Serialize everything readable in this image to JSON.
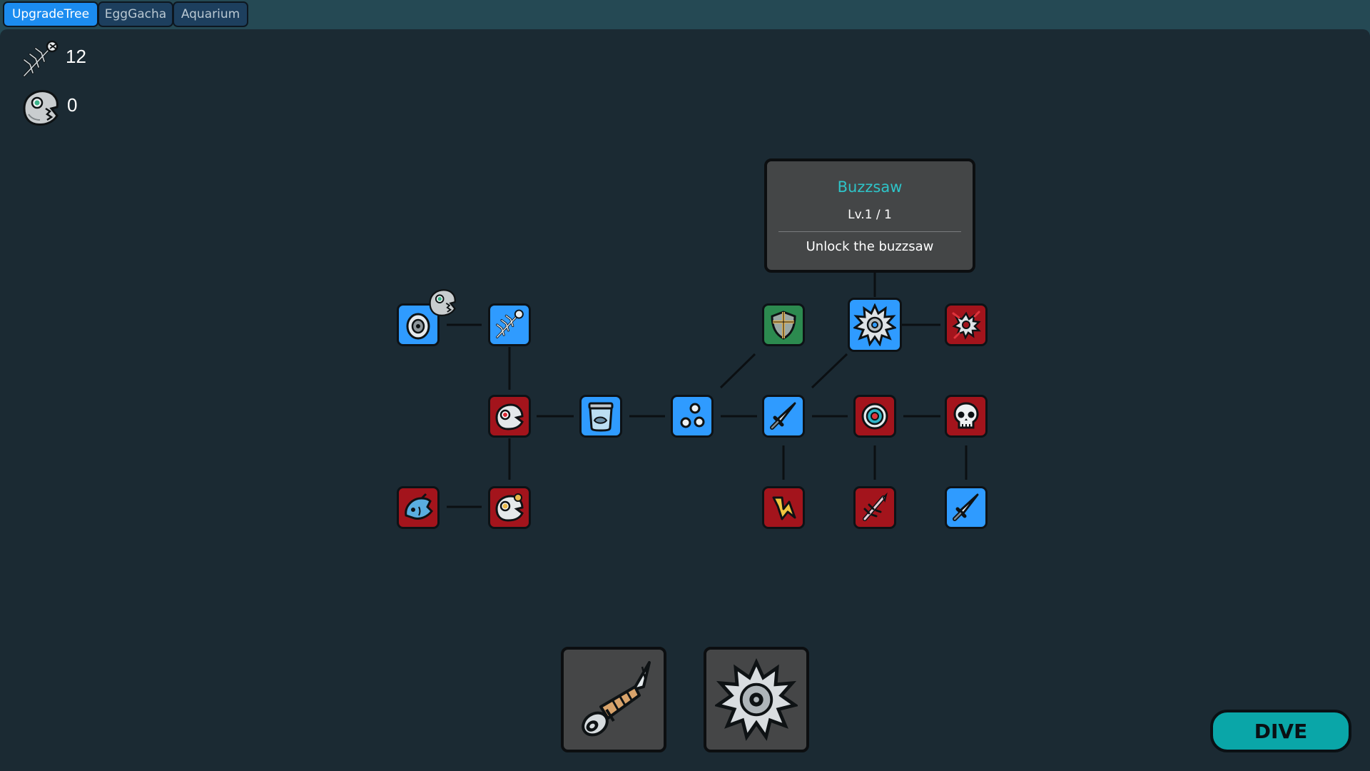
{
  "tabs": [
    {
      "label": "UpgradeTree",
      "active": true
    },
    {
      "label": "EggGacha",
      "active": false
    },
    {
      "label": "Aquarium",
      "active": false
    }
  ],
  "resources": {
    "bones": {
      "icon": "fish-bone-icon",
      "value": "12"
    },
    "skulls": {
      "icon": "fish-skull-icon",
      "value": "0"
    }
  },
  "colors": {
    "background": "#1b2a33",
    "node_blue": "#2f9bff",
    "node_red": "#a3141c",
    "node_green": "#2c8a4f",
    "accent_teal": "#0aa6a8",
    "tooltip_title": "#2ec4c8"
  },
  "upgrade_tree": {
    "nodes": [
      {
        "id": "target-disc",
        "icon": "target-disc-icon",
        "state": "unlocked"
      },
      {
        "id": "fish-bone",
        "icon": "fish-bone-icon",
        "state": "unlocked"
      },
      {
        "id": "shield",
        "icon": "shield-icon",
        "state": "special"
      },
      {
        "id": "buzzsaw",
        "icon": "buzzsaw-icon",
        "state": "unlocked",
        "selected": true
      },
      {
        "id": "shattered-saw",
        "icon": "shattered-saw-icon",
        "state": "locked"
      },
      {
        "id": "fish-eye",
        "icon": "fish-eye-icon",
        "state": "locked"
      },
      {
        "id": "fish-jar",
        "icon": "fish-jar-icon",
        "state": "unlocked"
      },
      {
        "id": "bubbles",
        "icon": "bubbles-icon",
        "state": "unlocked"
      },
      {
        "id": "knife",
        "icon": "knife-icon",
        "state": "unlocked"
      },
      {
        "id": "bullseye",
        "icon": "bullseye-icon",
        "state": "locked"
      },
      {
        "id": "skull",
        "icon": "skull-icon",
        "state": "locked"
      },
      {
        "id": "fish",
        "icon": "fish-icon",
        "state": "locked"
      },
      {
        "id": "golden-eye",
        "icon": "golden-eye-icon",
        "state": "locked"
      },
      {
        "id": "lightning",
        "icon": "lightning-icon",
        "state": "locked"
      },
      {
        "id": "bone-spike",
        "icon": "bone-spike-icon",
        "state": "locked"
      },
      {
        "id": "knife-2",
        "icon": "knife-icon",
        "state": "unlocked"
      }
    ]
  },
  "tooltip": {
    "title": "Buzzsaw",
    "level": "Lv.1 / 1",
    "description": "Unlock the buzzsaw"
  },
  "equipment": [
    {
      "icon": "harpoon-knife-icon"
    },
    {
      "icon": "buzzsaw-icon"
    }
  ],
  "dive_button": {
    "label": "DIVE"
  }
}
